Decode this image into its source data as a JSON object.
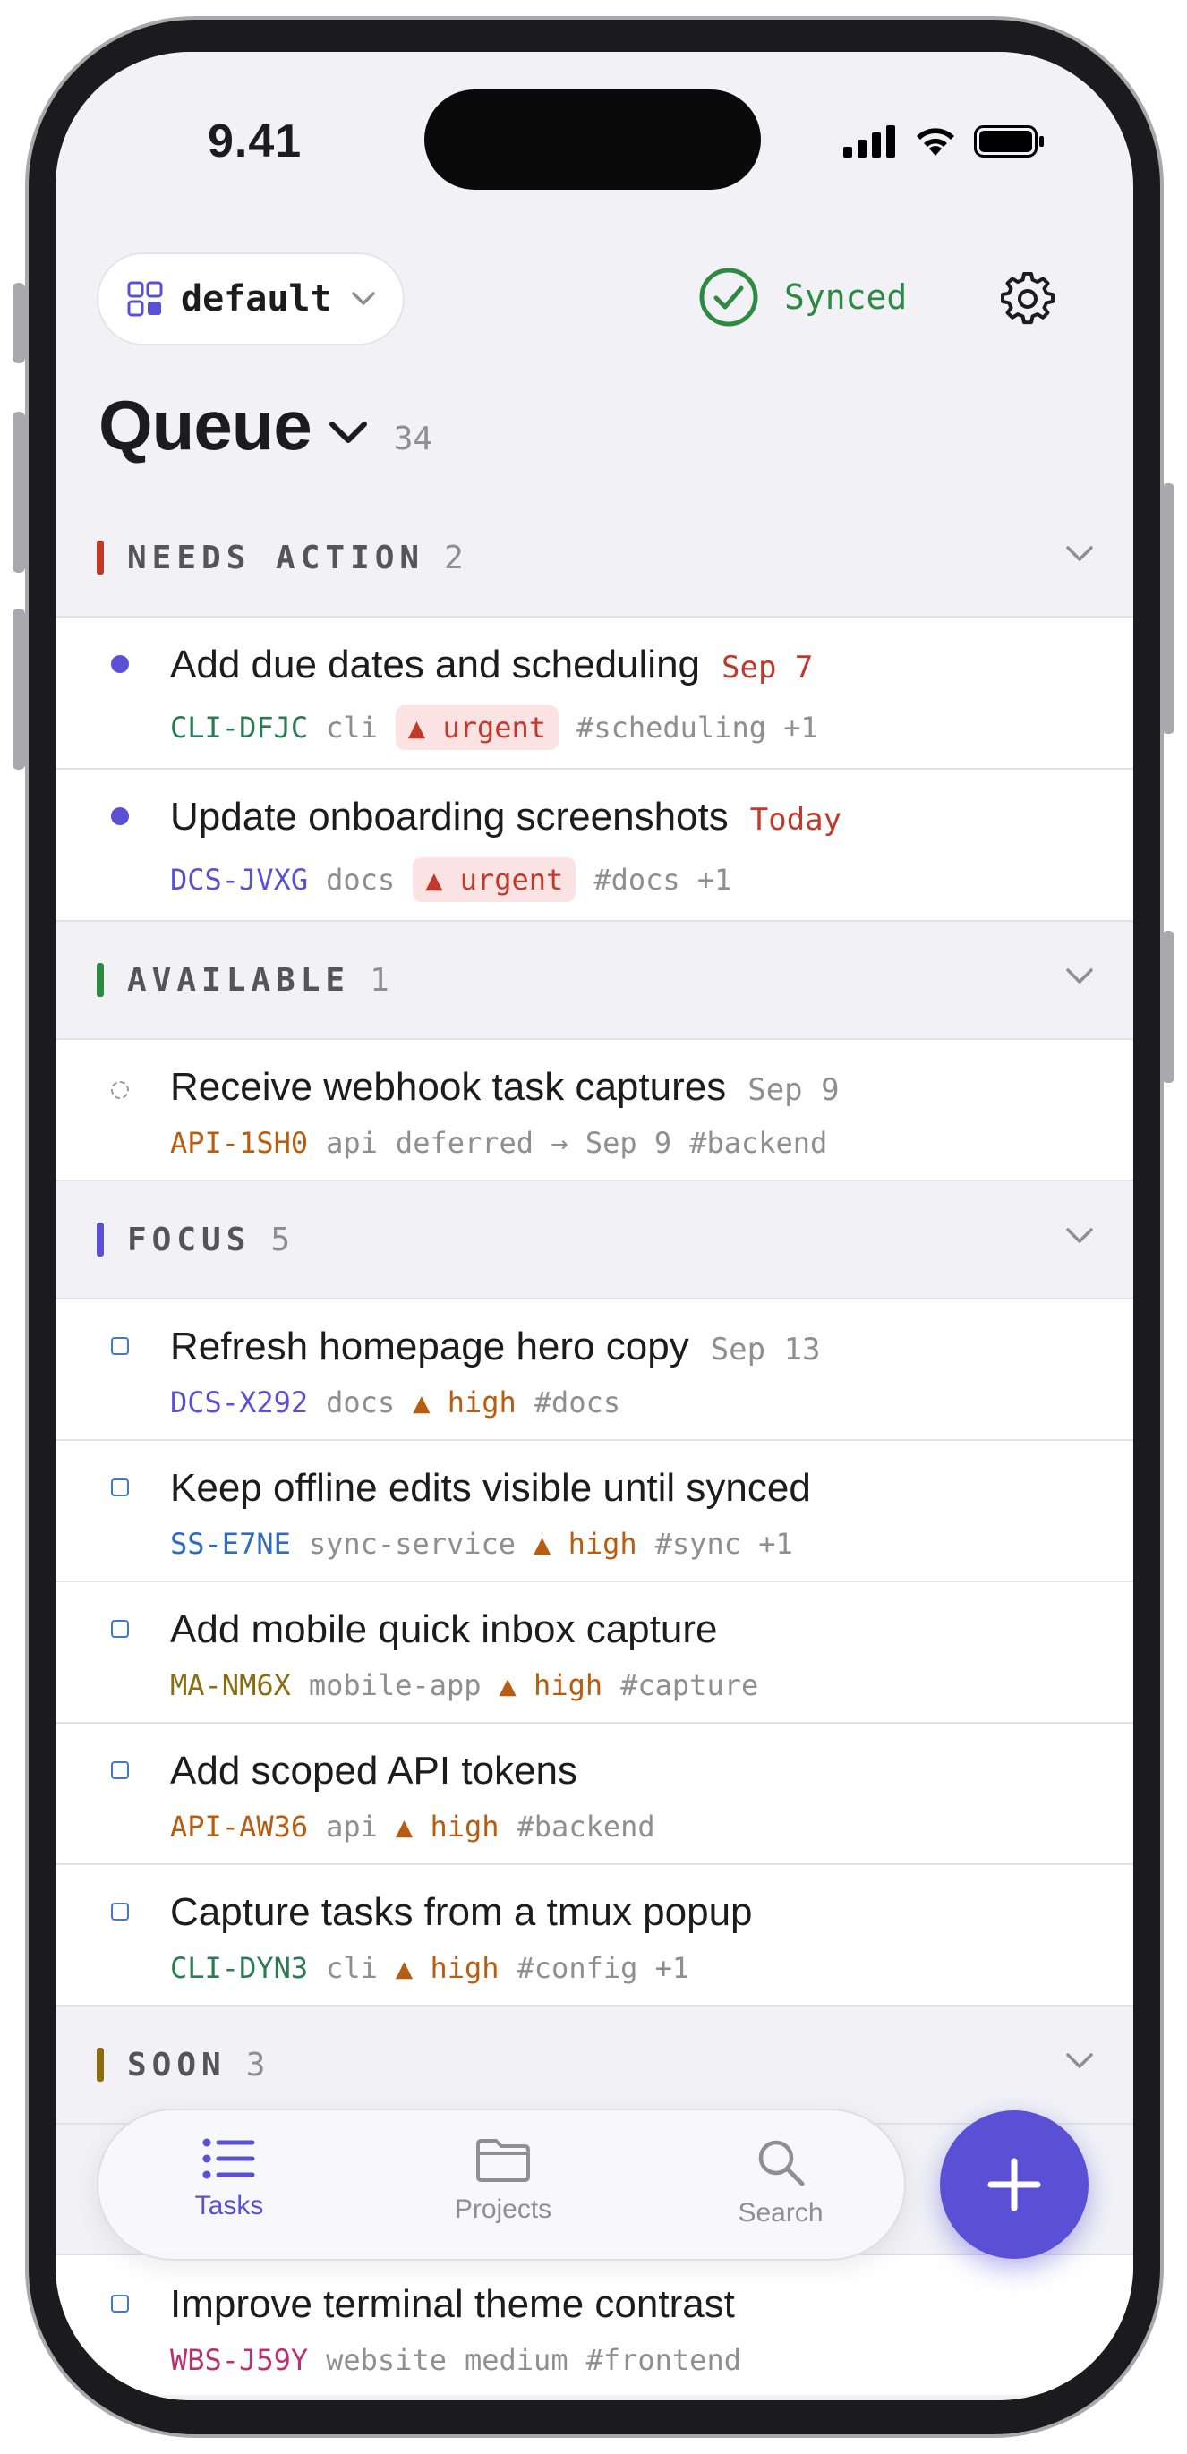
{
  "status": {
    "time": "9.41"
  },
  "header": {
    "workspace": "default",
    "sync_label": "Synced",
    "title": "Queue",
    "count": "34"
  },
  "colors": {
    "accent": "#5a50d6",
    "urgent": "#c0392b",
    "high": "#b85c10",
    "synced": "#2e8a43"
  },
  "sections": [
    {
      "title": "NEEDS ACTION",
      "count": "2",
      "color": "#c0392b",
      "rows": [
        {
          "title": "Add due dates and scheduling",
          "date": "Sep 7",
          "id": "CLI-DFJC",
          "id_color": "#2a7a52",
          "project": "cli",
          "priority": "▲ urgent",
          "extra": "#scheduling +1"
        },
        {
          "title": "Update onboarding screenshots",
          "date": "Today",
          "id": "DCS-JVXG",
          "id_color": "#5a50d6",
          "project": "docs",
          "priority": "▲ urgent",
          "extra": "#docs +1"
        }
      ]
    },
    {
      "title": "AVAILABLE",
      "count": "1",
      "color": "#2e8a43",
      "rows": [
        {
          "title": "Receive webhook task captures",
          "date": "Sep 9",
          "id": "API-1SH0",
          "id_color": "#b85c10",
          "project": "api",
          "status": "deferred → Sep 9",
          "extra": "#backend"
        }
      ]
    },
    {
      "title": "FOCUS",
      "count": "5",
      "color": "#5a50d6",
      "rows": [
        {
          "title": "Refresh homepage hero copy",
          "date": "Sep 13",
          "id": "DCS-X292",
          "id_color": "#5a50d6",
          "project": "docs",
          "priority": "▲ high",
          "extra": "#docs"
        },
        {
          "title": "Keep offline edits visible until synced",
          "id": "SS-E7NE",
          "id_color": "#2f6cc0",
          "project": "sync-service",
          "priority": "▲ high",
          "extra": "#sync +1"
        },
        {
          "title": "Add mobile quick inbox capture",
          "id": "MA-NM6X",
          "id_color": "#8a6d10",
          "project": "mobile-app",
          "priority": "▲ high",
          "extra": "#capture"
        },
        {
          "title": "Add scoped API tokens",
          "id": "API-AW36",
          "id_color": "#b85c10",
          "project": "api",
          "priority": "▲ high",
          "extra": "#backend"
        },
        {
          "title": "Capture tasks from a tmux popup",
          "id": "CLI-DYN3",
          "id_color": "#2a7a52",
          "project": "cli",
          "priority": "▲ high",
          "extra": "#config +1"
        }
      ]
    },
    {
      "title": "SOON",
      "count": "3",
      "color": "#8a6d10",
      "rows": [
        {
          "title": "Improve terminal theme contrast",
          "id": "WBS-J59Y",
          "id_color": "#b8326e",
          "project": "website",
          "priority": "medium",
          "extra": "#frontend"
        }
      ]
    }
  ],
  "tabs": [
    {
      "label": "Tasks",
      "icon": "list-icon",
      "active": true
    },
    {
      "label": "Projects",
      "icon": "folder-icon",
      "active": false
    },
    {
      "label": "Search",
      "icon": "search-icon",
      "active": false
    }
  ],
  "fab": {
    "icon": "plus-icon"
  }
}
